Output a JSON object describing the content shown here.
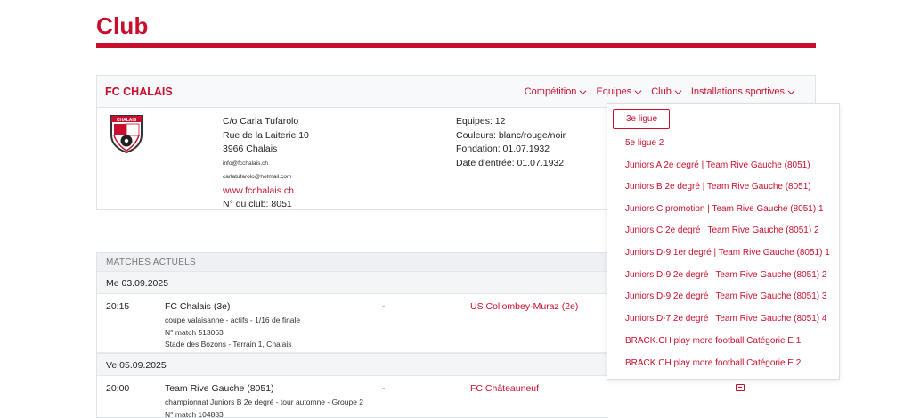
{
  "page": {
    "title": "Club"
  },
  "club": {
    "name": "FC CHALAIS",
    "nav": [
      {
        "label": "Compétition"
      },
      {
        "label": "Equipes"
      },
      {
        "label": "Club"
      },
      {
        "label": "Installations sportives"
      }
    ],
    "logo_text": "CHALAIS",
    "address": {
      "contact": "C/o Carla Tufarolo",
      "street": "Rue de la Laiterie 10",
      "city": "3966 Chalais",
      "email1": "info@fcchalais.ch",
      "email2": "carlatufarolo@hotmail.com",
      "website": "www.fcchalais.ch",
      "club_number": "N° du club: 8051"
    },
    "info": {
      "teams": "Equipes: 12",
      "colors": "Couleurs: blanc/rouge/noir",
      "founded": "Fondation: 01.07.1932",
      "entry_date": "Date d'entrée: 01.07.1932"
    }
  },
  "matches": {
    "header": "MATCHES ACTUELS",
    "days": [
      {
        "date": "Me 03.09.2025",
        "games": [
          {
            "time": "20:15",
            "home": "FC Chalais (3e)",
            "details": [
              "coupe valaisanne - actifs - 1/16 de finale",
              "N° match 513063",
              "Stade des Bozons - Terrain 1, Chalais"
            ],
            "separator": "-",
            "away": "US Collombey-Muraz (2e)"
          }
        ]
      },
      {
        "date": "Ve 05.09.2025",
        "games": [
          {
            "time": "20:00",
            "home": "Team Rive Gauche (8051)",
            "details": [
              "championnat Juniors B 2e degré - tour automne - Groupe 2",
              "N° match 104883"
            ],
            "separator": "-",
            "away": "FC Châteauneuf"
          }
        ]
      }
    ]
  },
  "dropdown": {
    "items": [
      "3e ligue",
      "5e ligue 2",
      "Juniors A 2e degré | Team Rive Gauche (8051)",
      "Juniors B 2e degré | Team Rive Gauche (8051)",
      "Juniors C promotion | Team Rive Gauche (8051) 1",
      "Juniors C 2e degré | Team Rive Gauche (8051) 2",
      "Juniors D-9 1er degré | Team Rive Gauche (8051) 1",
      "Juniors D-9 2e degré | Team Rive Gauche (8051) 2",
      "Juniors D-9 2e degré | Team Rive Gauche (8051) 3",
      "Juniors D-7 2e degré | Team Rive Gauche (8051) 4",
      "BRACK.CH play more football Catégorie E 1",
      "BRACK.CH play more football Catégorie E 2"
    ],
    "selected_index": 0
  },
  "colors": {
    "accent": "#c8102e",
    "header_bg": "#f7f9fb",
    "border": "#dfe3e8"
  },
  "icons": [
    "chevron-down-icon",
    "club-logo",
    "document-icon"
  ]
}
